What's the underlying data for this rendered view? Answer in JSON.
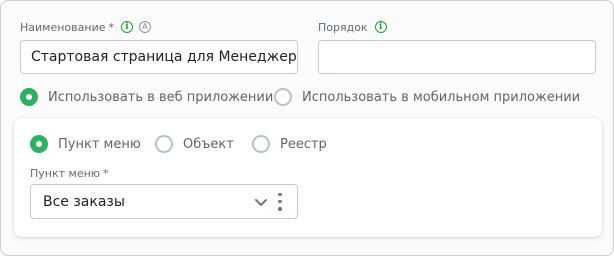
{
  "name_field": {
    "label": "Наименование",
    "required_mark": "*",
    "value": "Стартовая страница для Менеджера"
  },
  "order_field": {
    "label": "Порядок",
    "value": ""
  },
  "icons": {
    "info": "i",
    "auto": "A"
  },
  "usage": {
    "web_label": "Использовать в веб приложении",
    "mobile_label": "Использовать в мобильном приложении",
    "selected": "web"
  },
  "item_type": {
    "options": [
      "Пункт меню",
      "Объект",
      "Реестр"
    ],
    "selected": "Пункт меню"
  },
  "menu_item_field": {
    "label": "Пункт меню",
    "required_mark": "*",
    "value": "Все заказы"
  },
  "colors": {
    "accent": "#2fae64",
    "info": "#2e9a3a"
  }
}
